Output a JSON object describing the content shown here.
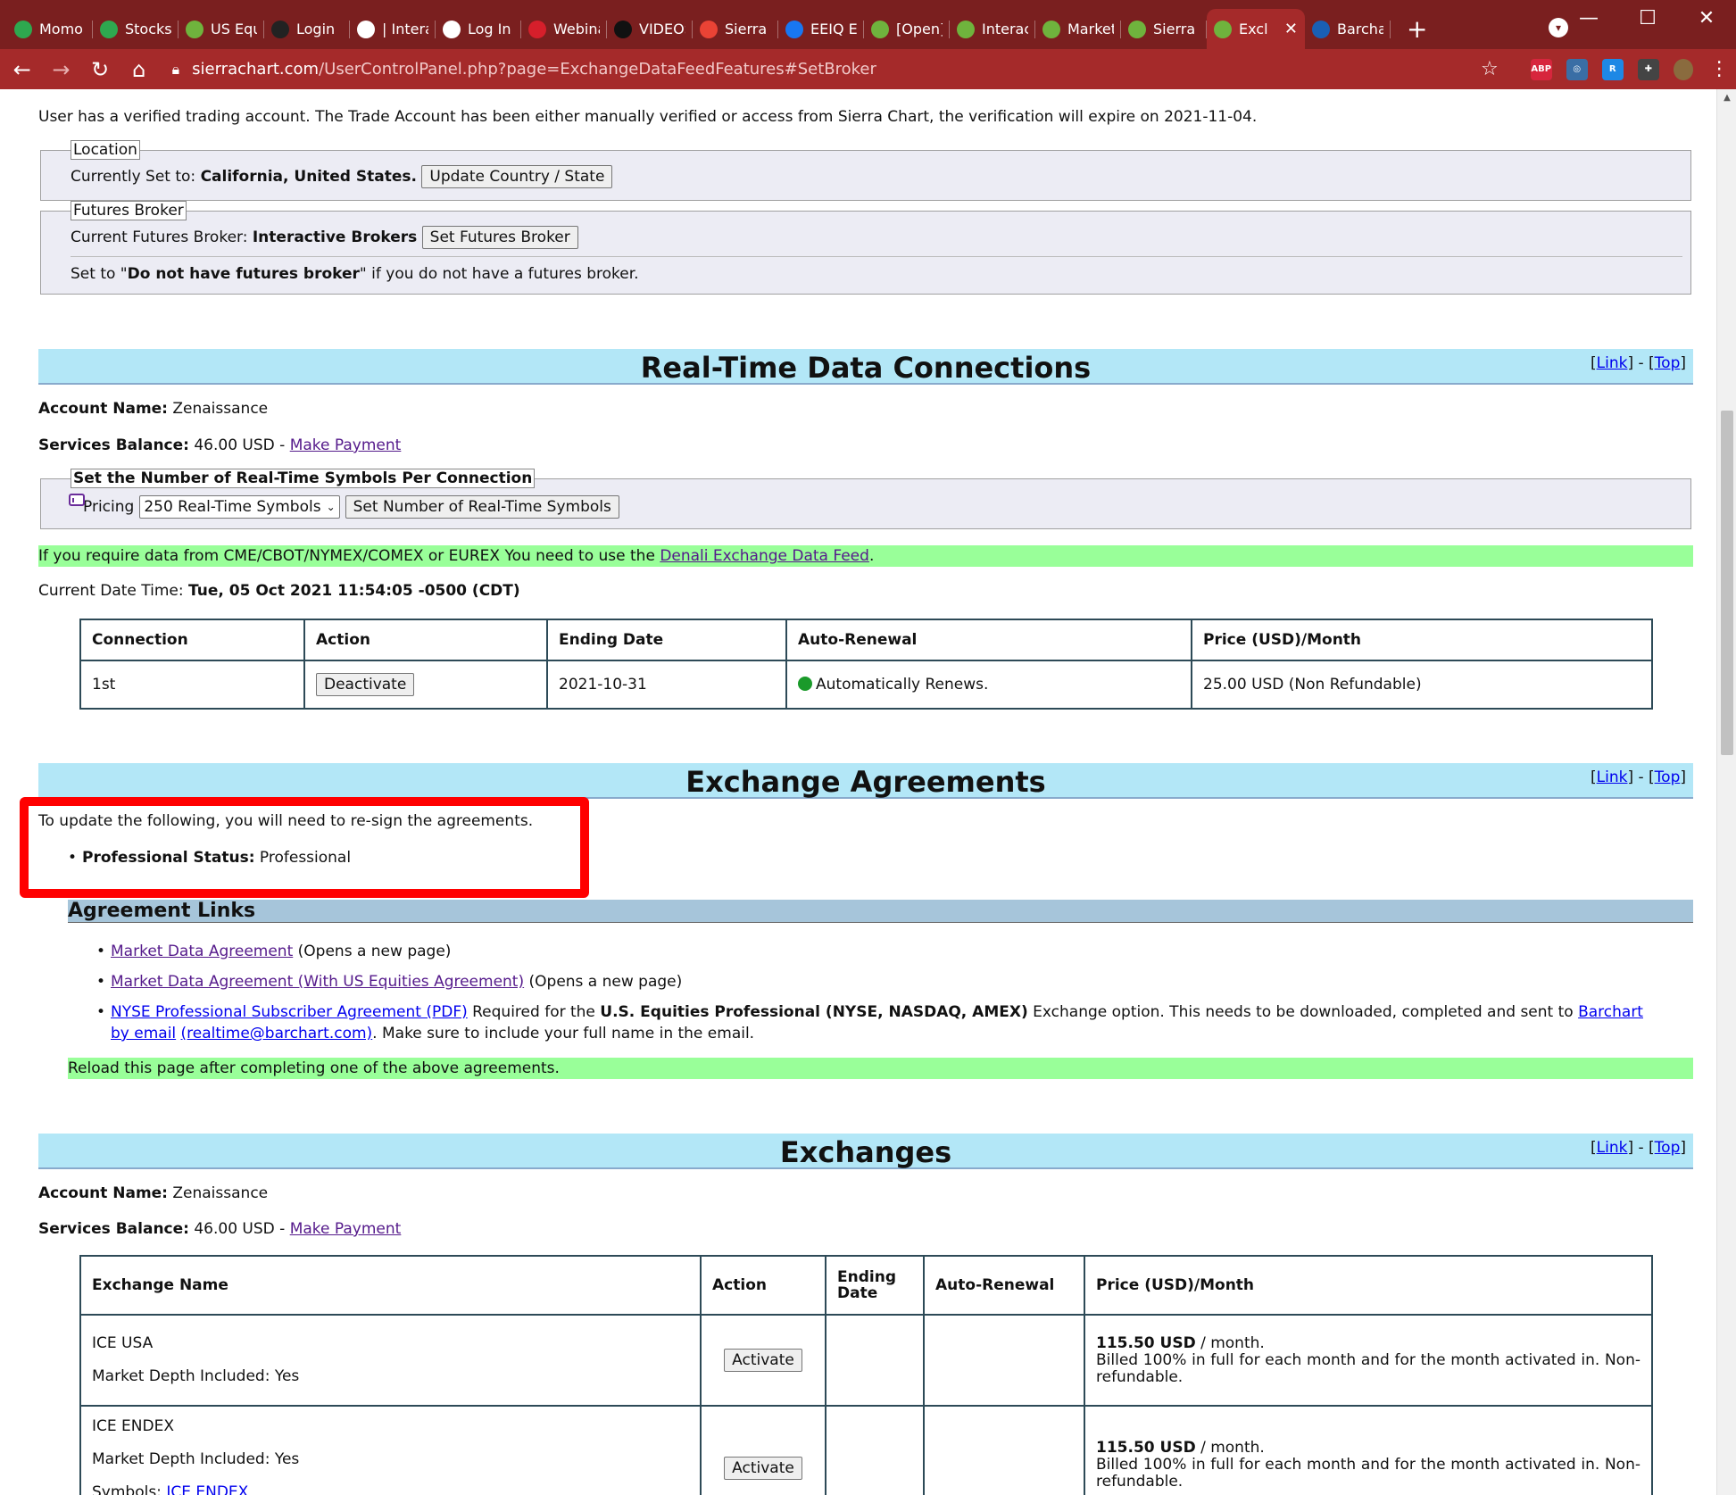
{
  "browser": {
    "tabs": [
      {
        "label": "Momo",
        "icon": "stocktwits-icon",
        "color": "#2ea84f"
      },
      {
        "label": "Stocks",
        "icon": "stocktwits-icon",
        "color": "#2ea84f"
      },
      {
        "label": "US Equi",
        "icon": "globe-icon",
        "color": "#6fb33d"
      },
      {
        "label": "Login",
        "icon": "login-icon",
        "color": "#222222"
      },
      {
        "label": "| Interac",
        "icon": "circle-icon",
        "color": "#ffffff"
      },
      {
        "label": "Log In",
        "icon": "check-icon",
        "color": "#ffffff"
      },
      {
        "label": "Webina",
        "icon": "webinar-icon",
        "color": "#d61f2b"
      },
      {
        "label": "VIDEOS",
        "icon": "bowtie-icon",
        "color": "#111111"
      },
      {
        "label": "Sierra C",
        "icon": "gmail-icon",
        "color": "#ea4335"
      },
      {
        "label": "EEIQ Eli",
        "icon": "facebook-icon",
        "color": "#1877f2"
      },
      {
        "label": "[Open]",
        "icon": "globe-icon",
        "color": "#6fb33d"
      },
      {
        "label": "Interact",
        "icon": "globe-icon",
        "color": "#6fb33d"
      },
      {
        "label": "Market",
        "icon": "globe-icon",
        "color": "#6fb33d"
      },
      {
        "label": "Sierra C",
        "icon": "globe-icon",
        "color": "#6fb33d"
      },
      {
        "label": "Excl",
        "icon": "globe-icon",
        "color": "#6fb33d",
        "active": true
      },
      {
        "label": "Barchar",
        "icon": "barchart-icon",
        "color": "#1a5fb4"
      }
    ],
    "url_host": "sierrachart.com",
    "url_path": "/UserControlPanel.php?page=ExchangeDataFeedFeatures#SetBroker",
    "extensions": [
      {
        "label": "ABP",
        "color": "#d7263d"
      },
      {
        "label": "◎",
        "color": "#3a6ea5"
      },
      {
        "label": "R",
        "color": "#1e88e5"
      },
      {
        "label": "✚",
        "color": "#444444"
      }
    ]
  },
  "verified_text": "User has a verified trading account. The Trade Account has been either manually verified or access from Sierra Chart, the verification will expire on 2021-11-04.",
  "location": {
    "legend": "Location",
    "prefix": "Currently Set to: ",
    "value": "California, United States.",
    "button": "Update Country / State"
  },
  "futures_broker": {
    "legend": "Futures Broker",
    "prefix": "Current Futures Broker: ",
    "value": "Interactive Brokers",
    "button": "Set Futures Broker",
    "note_prefix": "Set to \"",
    "note_bold": "Do not have futures broker",
    "note_suffix": "\" if you do not have a futures broker."
  },
  "section_links": {
    "link": "Link",
    "top": "Top",
    "sep": "] - [",
    "open": "[",
    "close": "]"
  },
  "realtime": {
    "title": "Real-Time Data Connections",
    "account_label": "Account Name:",
    "account_value": " Zenaissance",
    "balance_label": "Services Balance:",
    "balance_value": " 46.00 USD - ",
    "make_payment": "Make Payment",
    "symbols_legend": "Set the Number of Real-Time Symbols Per Connection",
    "pricing_label": "Pricing",
    "symbols_selected": "250 Real-Time Symbols",
    "symbols_button": "Set Number of Real-Time Symbols",
    "cme_prefix": "If you require data from CME/CBOT/NYMEX/COMEX or EUREX You need to use the ",
    "cme_link": "Denali Exchange Data Feed",
    "cme_suffix": ".",
    "datetime_label": "Current Date Time: ",
    "datetime_value": "Tue, 05 Oct 2021 11:54:05 -0500 (CDT)",
    "table_headers": [
      "Connection",
      "Action",
      "Ending Date",
      "Auto-Renewal",
      "Price (USD)/Month"
    ],
    "table_row": {
      "connection": "1st",
      "action": "Deactivate",
      "ending_date": "2021-10-31",
      "auto_renewal": "Automatically Renews.",
      "price": "25.00 USD (Non Refundable)"
    }
  },
  "agreements": {
    "title": "Exchange Agreements",
    "update_note": "To update the following, you will need to re-sign the agreements.",
    "status_label": "Professional Status:",
    "status_value": " Professional",
    "links_heading": "Agreement Links",
    "items": [
      {
        "link": "Market Data Agreement",
        "suffix": " (Opens a new page)"
      },
      {
        "link": "Market Data Agreement (With US Equities Agreement)",
        "suffix": " (Opens a new page)"
      }
    ],
    "nyse": {
      "link": "NYSE Professional Subscriber Agreement (PDF)",
      "mid1": " Required for the ",
      "bold": "U.S. Equities Professional (NYSE, NASDAQ, AMEX)",
      "mid2": " Exchange option. This needs to be downloaded, completed and sent to ",
      "email_link1": "Barchart by email",
      "email_link2": "(realtime@barchart.com)",
      "suffix": ". Make sure to include your full name in the email."
    },
    "reload_note": "Reload this page after completing one of the above agreements."
  },
  "exchanges": {
    "title": "Exchanges",
    "account_label": "Account Name:",
    "account_value": " Zenaissance",
    "balance_label": "Services Balance:",
    "balance_value": " 46.00 USD - ",
    "make_payment": "Make Payment",
    "table_headers": [
      "Exchange Name",
      "Action",
      "Ending Date",
      "Auto-Renewal",
      "Price (USD)/Month"
    ],
    "ending_date_line1": "Ending",
    "ending_date_line2": "Date",
    "rows": [
      {
        "name": "ICE USA",
        "depth": "Market Depth Included: Yes",
        "action": "Activate",
        "price_bold": "115.50 USD",
        "price_suffix": " / month.",
        "billing": "Billed 100% in full for each month and for the month activated in. Non-refundable."
      },
      {
        "name": "ICE ENDEX",
        "depth": "Market Depth Included: Yes",
        "symbols_label": "Symbols: ",
        "symbols_link": "ICE ENDEX",
        "action": "Activate",
        "price_bold": "115.50 USD",
        "price_suffix": " / month.",
        "billing": "Billed 100% in full for each month and for the month activated in. Non-refundable."
      }
    ]
  }
}
